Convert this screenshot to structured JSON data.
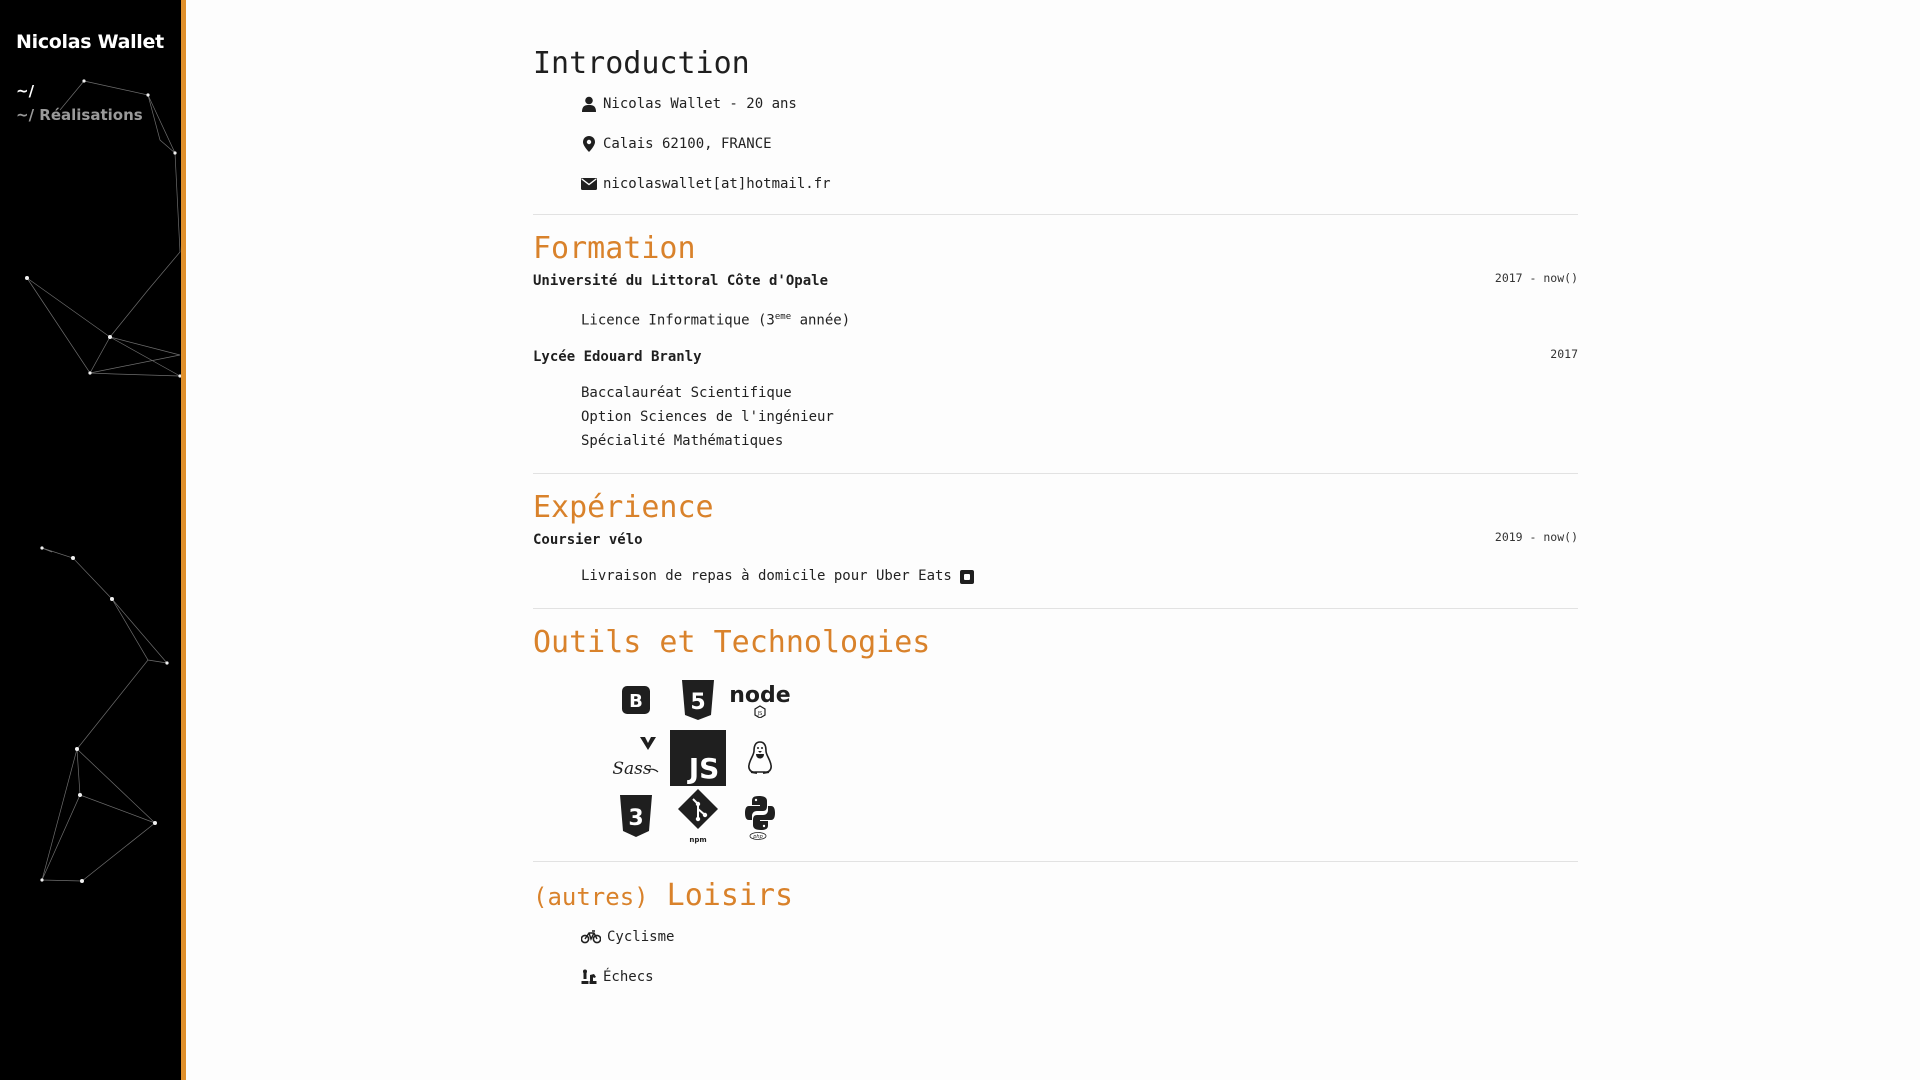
{
  "sidebar": {
    "brand": "Nicolas Wallet",
    "nav": [
      {
        "label": "~/"
      },
      {
        "label": "~/ Réalisations"
      }
    ]
  },
  "intro": {
    "title": "Introduction",
    "items": [
      {
        "icon": "user-icon",
        "text": "Nicolas Wallet - 20 ans"
      },
      {
        "icon": "map-marker-icon",
        "text": "Calais 62100, FRANCE"
      },
      {
        "icon": "envelope-icon",
        "text": "nicolaswallet[at]hotmail.fr"
      }
    ]
  },
  "formation": {
    "title": "Formation",
    "entries": [
      {
        "org": "Université du Littoral Côte d'Opale",
        "date": "2017 - now()",
        "lines": [
          "Licence Informatique (3",
          "eme",
          " année)"
        ]
      },
      {
        "org": "Lycée Edouard Branly",
        "date": "2017",
        "lines": [
          "Baccalauréat Scientifique",
          "Option Sciences de l'ingénieur",
          "Spécialité Mathématiques"
        ]
      }
    ]
  },
  "experience": {
    "title": "Expérience",
    "entries": [
      {
        "org": "Coursier vélo",
        "date": "2019 - now()",
        "text": "Livraison de repas à domicile pour Uber Eats"
      }
    ]
  },
  "tools": {
    "title": "Outils et Technologies",
    "icons": [
      "bootstrap-icon",
      "html5-icon",
      "nodejs-icon",
      "sass-vue-icon",
      "javascript-icon",
      "linux-icon",
      "css3-icon",
      "git-npm-icon",
      "python-php-icon"
    ],
    "labels": {
      "bootstrap": "B",
      "html5": "5",
      "node": "node",
      "js_label": "JS",
      "js": "JS",
      "css3": "3",
      "sass": "Sass",
      "npm": "npm",
      "php": "php"
    }
  },
  "hobbies": {
    "title_prefix": "(autres)",
    "title": "Loisirs",
    "items": [
      {
        "icon": "bicycle-icon",
        "text": "Cyclisme"
      },
      {
        "icon": "chess-icon",
        "text": "Échecs"
      }
    ]
  },
  "colors": {
    "accent": "#d9822b",
    "sidebar_bg": "#000000",
    "sidebar_border": "#e0902c"
  }
}
